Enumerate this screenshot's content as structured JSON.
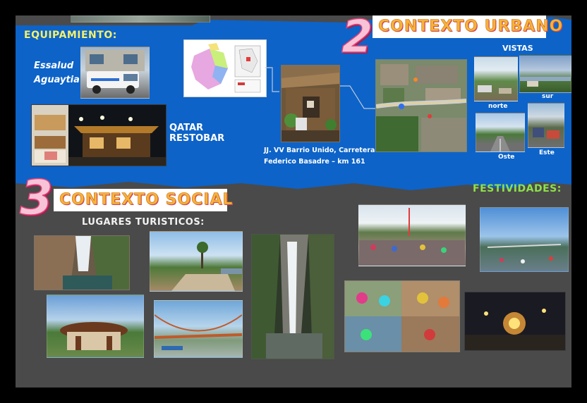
{
  "urban": {
    "number": "2",
    "title": "CONTEXTO URBANO",
    "equipment_label": "EQUIPAMIENTO:",
    "essalud_line1": "Essalud",
    "essalud_line2": "Aguaytia",
    "qatar_line1": "QATAR",
    "qatar_line2": "RESTOBAR",
    "address_line1": "JJ. VV Barrio Unido, Carretera",
    "address_line2": "Federico Basadre – km 161",
    "views_label": "VISTAS",
    "view_norte": "norte",
    "view_sur": "sur",
    "view_oeste": "Oste",
    "view_este": "Este"
  },
  "social": {
    "number": "3",
    "title": "CONTEXTO SOCIAL",
    "tourist_label": "LUGARES TURISTICOS:",
    "festivities_label": "FESTIVIDADES:"
  },
  "colors": {
    "blue": "#0d63c8",
    "board": "#4a4a4a",
    "yellow_label": "#f4f06a",
    "festivities_label": "#8fe04a",
    "pink": "#e0407a",
    "orange_title": "#f7b23b"
  }
}
